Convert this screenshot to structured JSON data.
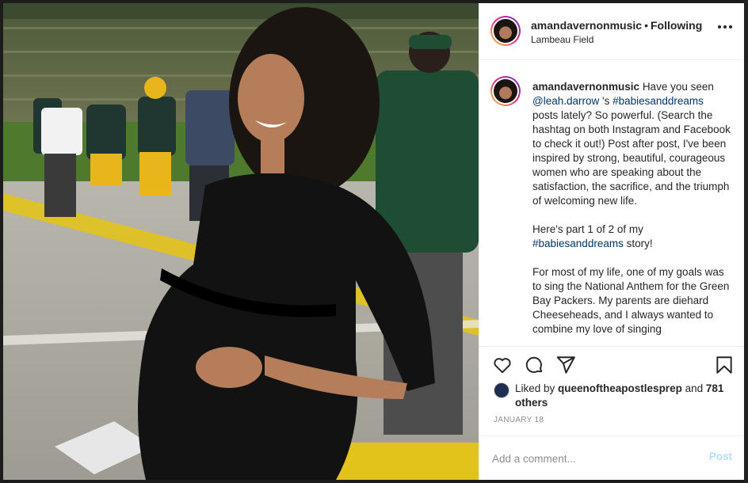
{
  "post": {
    "username": "amandavernonmusic",
    "separator": "•",
    "follow_state": "Following",
    "location": "Lambeau Field",
    "more_icon": "more-horizontal-icon"
  },
  "caption": {
    "username": "amandavernonmusic",
    "p1_a": "Have you seen ",
    "p1_mention": "@leah.darrow",
    "p1_b": " 's ",
    "p1_tag": "#babiesanddreams",
    "p1_c": " posts lately? So powerful. (Search the hashtag on both Instagram and Facebook to check it out!) Post after post, I've been inspired by strong, beautiful, courageous women who are speaking about the satisfaction, the sacrifice, and the triumph of welcoming new life.",
    "p2_a": "Here's part 1 of 2 of my ",
    "p2_tag": "#babiesanddreams",
    "p2_b": " story!",
    "p3": "For most of my life, one of my goals was to sing the National Anthem for the Green Bay Packers. My parents are diehard Cheeseheads, and I always wanted to combine my love of singing"
  },
  "actions": {
    "like": "heart-icon",
    "comment": "comment-icon",
    "share": "paper-plane-icon",
    "save": "bookmark-icon"
  },
  "likes": {
    "prefix": "Liked by ",
    "user": "queenoftheapostlesprep",
    "middle": " and ",
    "others": "781 others"
  },
  "timestamp": "JANUARY 18",
  "comment": {
    "placeholder": "Add a comment...",
    "post_label": "Post"
  },
  "colors": {
    "link": "#00376b",
    "post_disabled": "#b2dffc",
    "border": "#efefef",
    "muted": "#8e8e8e"
  }
}
